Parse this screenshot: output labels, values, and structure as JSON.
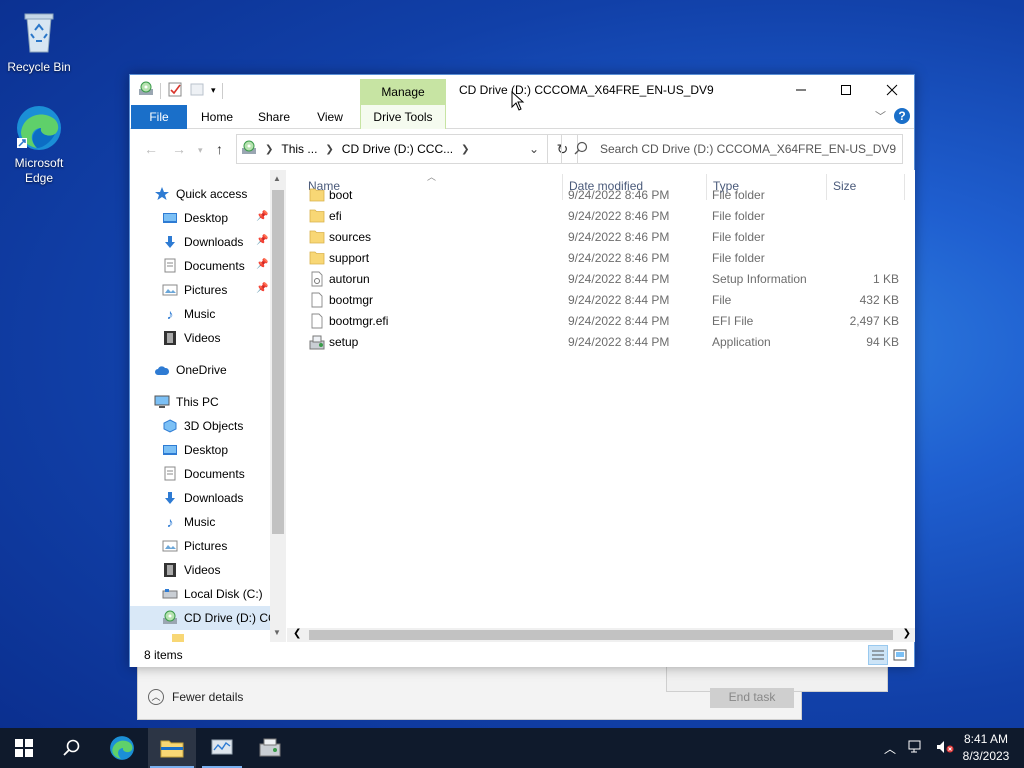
{
  "desktop": {
    "icons": [
      {
        "label": "Recycle Bin",
        "icon": "recycle-bin-icon"
      },
      {
        "label": "Microsoft Edge",
        "icon": "edge-icon"
      }
    ]
  },
  "background_window": {
    "fewer_details_label": "Fewer details",
    "end_task_label": "End task"
  },
  "explorer": {
    "title": "CD Drive (D:) CCCOMA_X64FRE_EN-US_DV9",
    "contextual_tab_group": "Manage",
    "ribbon_tabs": {
      "file": "File",
      "home": "Home",
      "share": "Share",
      "view": "View",
      "drive_tools": "Drive Tools"
    },
    "address": {
      "crumb1": "This ...",
      "crumb2": "CD Drive (D:) CCC..."
    },
    "search_placeholder": "Search CD Drive (D:) CCCOMA_X64FRE_EN-US_DV9",
    "nav": {
      "quick_access": "Quick access",
      "qa_items": [
        "Desktop",
        "Downloads",
        "Documents",
        "Pictures",
        "Music",
        "Videos"
      ],
      "onedrive": "OneDrive",
      "this_pc": "This PC",
      "pc_items": [
        "3D Objects",
        "Desktop",
        "Documents",
        "Downloads",
        "Music",
        "Pictures",
        "Videos",
        "Local Disk (C:)",
        "CD Drive (D:) CC"
      ]
    },
    "columns": {
      "name": "Name",
      "date": "Date modified",
      "type": "Type",
      "size": "Size"
    },
    "files": [
      {
        "name": "boot",
        "date": "9/24/2022 8:46 PM",
        "type": "File folder",
        "size": "",
        "icon": "folder-icon"
      },
      {
        "name": "efi",
        "date": "9/24/2022 8:46 PM",
        "type": "File folder",
        "size": "",
        "icon": "folder-icon"
      },
      {
        "name": "sources",
        "date": "9/24/2022 8:46 PM",
        "type": "File folder",
        "size": "",
        "icon": "folder-icon"
      },
      {
        "name": "support",
        "date": "9/24/2022 8:46 PM",
        "type": "File folder",
        "size": "",
        "icon": "folder-icon"
      },
      {
        "name": "autorun",
        "date": "9/24/2022 8:44 PM",
        "type": "Setup Information",
        "size": "1 KB",
        "icon": "setup-info-icon"
      },
      {
        "name": "bootmgr",
        "date": "9/24/2022 8:44 PM",
        "type": "File",
        "size": "432 KB",
        "icon": "file-icon"
      },
      {
        "name": "bootmgr.efi",
        "date": "9/24/2022 8:44 PM",
        "type": "EFI File",
        "size": "2,497 KB",
        "icon": "file-icon"
      },
      {
        "name": "setup",
        "date": "9/24/2022 8:44 PM",
        "type": "Application",
        "size": "94 KB",
        "icon": "setup-app-icon"
      }
    ],
    "status_count": "8 items"
  },
  "taskbar": {
    "time": "8:41 AM",
    "date": "8/3/2023"
  },
  "colors": {
    "accent": "#1a6fc9",
    "manage_tab": "#c7e4a3",
    "folder": "#f8d775",
    "taskbar": "#0f1a2c"
  }
}
